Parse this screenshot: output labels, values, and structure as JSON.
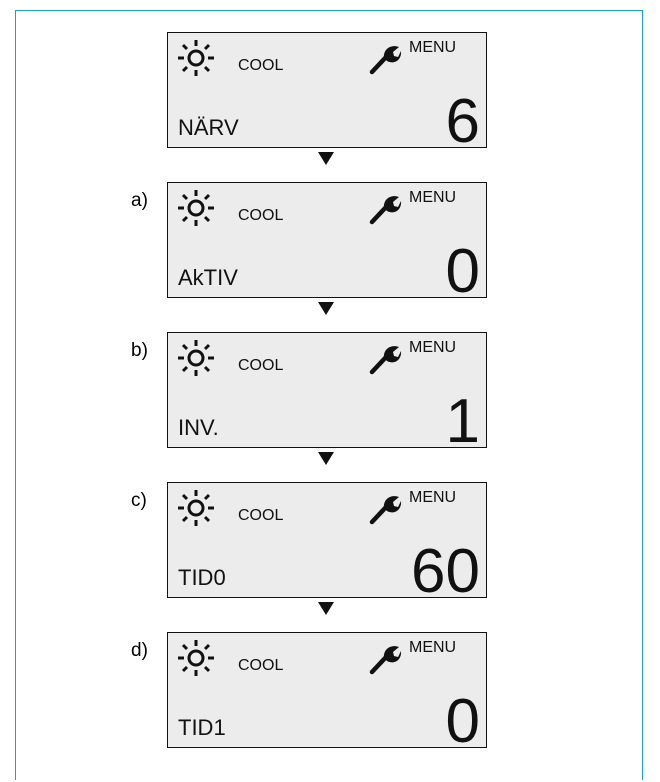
{
  "colors": {
    "frame_border": "#1b9fd8",
    "lcd_background": "#ececec",
    "ink": "#111111"
  },
  "icons": {
    "mode": "sun-icon",
    "settings": "wrench-icon",
    "next": "down-arrow-icon"
  },
  "steps": [
    {
      "label": "",
      "mode": "COOL",
      "menu": "MENU",
      "param": "NÄRV",
      "value": "6"
    },
    {
      "label": "a)",
      "mode": "COOL",
      "menu": "MENU",
      "param": "AkTIV",
      "value": "0"
    },
    {
      "label": "b)",
      "mode": "COOL",
      "menu": "MENU",
      "param": "INV.",
      "value": "1"
    },
    {
      "label": "c)",
      "mode": "COOL",
      "menu": "MENU",
      "param": "TID0",
      "value": "60"
    },
    {
      "label": "d)",
      "mode": "COOL",
      "menu": "MENU",
      "param": "TID1",
      "value": "0"
    }
  ]
}
